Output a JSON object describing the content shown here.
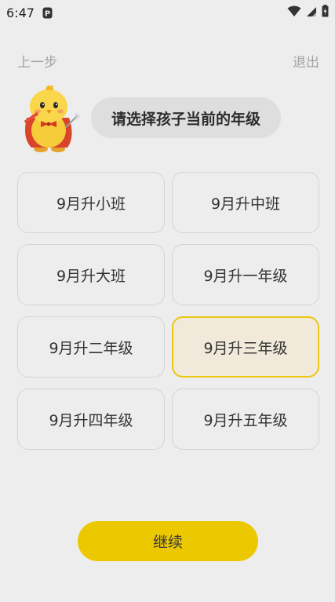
{
  "status_bar": {
    "time": "6:47",
    "app_icon": "parking-icon",
    "wifi_icon": "wifi-icon",
    "signal_icon": "signal-icon",
    "battery_icon": "battery-icon"
  },
  "nav": {
    "back_label": "上一步",
    "exit_label": "退出"
  },
  "prompt": {
    "mascot_icon": "chick-mascot-icon",
    "question": "请选择孩子当前的年级"
  },
  "grades": [
    {
      "label": "9月升小班",
      "selected": false
    },
    {
      "label": "9月升中班",
      "selected": false
    },
    {
      "label": "9月升大班",
      "selected": false
    },
    {
      "label": "9月升一年级",
      "selected": false
    },
    {
      "label": "9月升二年级",
      "selected": false
    },
    {
      "label": "9月升三年级",
      "selected": true
    },
    {
      "label": "9月升四年级",
      "selected": false
    },
    {
      "label": "9月升五年级",
      "selected": false
    }
  ],
  "continue_label": "继续",
  "colors": {
    "background": "#ededed",
    "accent": "#ecc800",
    "selected_fill": "#f1eadb",
    "selected_border": "#ecc815"
  }
}
